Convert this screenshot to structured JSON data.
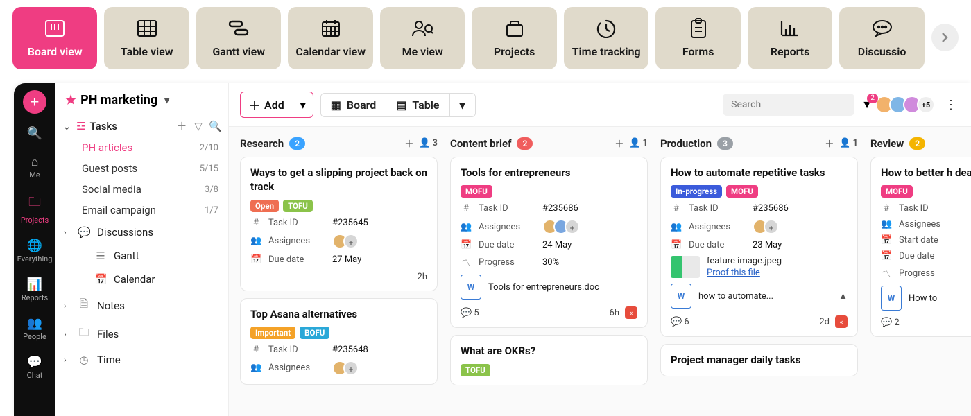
{
  "topnav": {
    "tiles": [
      {
        "label": "Board view",
        "icon": "board"
      },
      {
        "label": "Table view",
        "icon": "table"
      },
      {
        "label": "Gantt view",
        "icon": "gantt"
      },
      {
        "label": "Calendar view",
        "icon": "calendar"
      },
      {
        "label": "Me view",
        "icon": "me"
      },
      {
        "label": "Projects",
        "icon": "projects"
      },
      {
        "label": "Time tracking",
        "icon": "time"
      },
      {
        "label": "Forms",
        "icon": "forms"
      },
      {
        "label": "Reports",
        "icon": "reports"
      },
      {
        "label": "Discussio",
        "icon": "discussion"
      }
    ],
    "active_index": 0
  },
  "rail": {
    "items": [
      {
        "label": "",
        "icon": "search"
      },
      {
        "label": "Me",
        "icon": "home"
      },
      {
        "label": "Projects",
        "icon": "folder"
      },
      {
        "label": "Everything",
        "icon": "globe"
      },
      {
        "label": "Reports",
        "icon": "bars"
      },
      {
        "label": "People",
        "icon": "people"
      },
      {
        "label": "Chat",
        "icon": "chat"
      }
    ],
    "active_index": 2
  },
  "sidebar": {
    "project_name": "PH marketing",
    "tasks_label": "Tasks",
    "task_lists": [
      {
        "label": "PH articles",
        "count": "2/10",
        "active": true
      },
      {
        "label": "Guest posts",
        "count": "5/15"
      },
      {
        "label": "Social media",
        "count": "3/8"
      },
      {
        "label": "Email campaign",
        "count": "1/7"
      }
    ],
    "sections": [
      {
        "label": "Discussions",
        "icon": "chat",
        "collapsible": true
      },
      {
        "label": "Gantt",
        "icon": "gantt",
        "indent": true
      },
      {
        "label": "Calendar",
        "icon": "calendar",
        "indent": true
      },
      {
        "label": "Notes",
        "icon": "note",
        "collapsible": true
      },
      {
        "label": "Files",
        "icon": "file",
        "collapsible": true
      },
      {
        "label": "Time",
        "icon": "clock",
        "collapsible": true
      }
    ]
  },
  "toolbar": {
    "add_label": "Add",
    "view_board": "Board",
    "view_table": "Table",
    "search_placeholder": "Search",
    "filter_badge": "2",
    "avatars_more": "+5"
  },
  "columns": [
    {
      "title": "Research",
      "count": "2",
      "count_color": "blue",
      "people": "3",
      "cards": [
        {
          "title": "Ways to get a slipping project back on track",
          "tags": [
            {
              "t": "Open",
              "c": "open"
            },
            {
              "t": "TOFU",
              "c": "tofu"
            }
          ],
          "rows": [
            {
              "icon": "hash",
              "label": "Task ID",
              "value": "#235645"
            },
            {
              "icon": "people",
              "label": "Assignees",
              "value_avatars": [
                "a",
                "+"
              ]
            },
            {
              "icon": "cal",
              "label": "Due date",
              "value": "27 May"
            }
          ],
          "foot": {
            "right_text": "2h"
          }
        },
        {
          "title": "Top Asana alternatives",
          "tags": [
            {
              "t": "Important",
              "c": "important"
            },
            {
              "t": "BOFU",
              "c": "bofu"
            }
          ],
          "rows": [
            {
              "icon": "hash",
              "label": "Task ID",
              "value": "#235648"
            },
            {
              "icon": "people",
              "label": "Assignees",
              "value_avatars": [
                "a",
                "+"
              ]
            }
          ]
        }
      ]
    },
    {
      "title": "Content brief",
      "count": "2",
      "count_color": "red",
      "people": "1",
      "cards": [
        {
          "title": "Tools for entrepreneurs",
          "tags": [
            {
              "t": "MOFU",
              "c": "mofu"
            }
          ],
          "rows": [
            {
              "icon": "hash",
              "label": "Task ID",
              "value": "#235686"
            },
            {
              "icon": "people",
              "label": "Assignees",
              "value_avatars": [
                "a",
                "b",
                "+"
              ]
            },
            {
              "icon": "cal",
              "label": "Due date",
              "value": "24 May"
            },
            {
              "icon": "prog",
              "label": "Progress",
              "value": "30%"
            }
          ],
          "attachment": {
            "type": "doc",
            "name": "Tools for entrepreneurs.doc"
          },
          "foot": {
            "comments": "5",
            "right_text": "6h",
            "priority": true
          }
        },
        {
          "title": "What are OKRs?",
          "tags": [
            {
              "t": "TOFU",
              "c": "tofu"
            }
          ]
        }
      ]
    },
    {
      "title": "Production",
      "count": "3",
      "count_color": "gray",
      "people": "1",
      "cards": [
        {
          "title": "How to automate repetitive tasks",
          "tags": [
            {
              "t": "In-progress",
              "c": "inprog"
            },
            {
              "t": "MOFU",
              "c": "mofu"
            }
          ],
          "rows": [
            {
              "icon": "hash",
              "label": "Task ID",
              "value": "#235686"
            },
            {
              "icon": "people",
              "label": "Assignees",
              "value_avatars": [
                "a",
                "+"
              ]
            },
            {
              "icon": "cal",
              "label": "Due date",
              "value": "23 May"
            }
          ],
          "image_att": {
            "name": "feature image.jpeg",
            "proof": "Proof this file"
          },
          "attachment": {
            "type": "doc",
            "name": "how to automate...",
            "drive": true
          },
          "foot": {
            "comments": "6",
            "right_text": "2d",
            "priority": true
          }
        },
        {
          "title": "Project manager daily tasks"
        }
      ]
    },
    {
      "title": "Review",
      "count": "2",
      "count_color": "yellow",
      "cards": [
        {
          "title": "How to better h\ndeadlines as a",
          "tags": [
            {
              "t": "MOFU",
              "c": "mofu"
            }
          ],
          "rows": [
            {
              "icon": "hash",
              "label": "Task ID",
              "value": ""
            },
            {
              "icon": "people",
              "label": "Assignees",
              "value": ""
            },
            {
              "icon": "cal",
              "label": "Start date",
              "value": ""
            },
            {
              "icon": "cal",
              "label": "Due date",
              "value": ""
            },
            {
              "icon": "prog",
              "label": "Progress",
              "value": ""
            }
          ],
          "attachment": {
            "type": "doc",
            "name": "How to"
          },
          "foot": {
            "comments": "2"
          }
        }
      ]
    }
  ]
}
